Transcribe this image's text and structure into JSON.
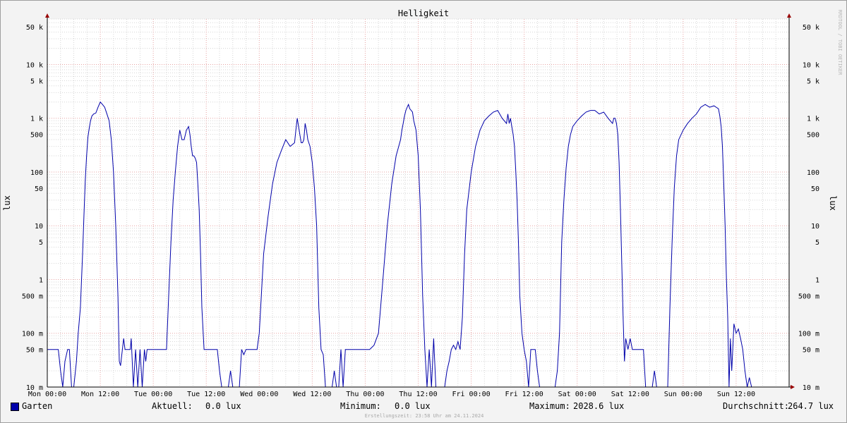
{
  "colors": {
    "background": "#f3f3f3",
    "canvas": "#ffffff",
    "line": "#0000aa",
    "grid_major": "#e7a3a3",
    "grid_minor": "#d6d6d6",
    "axis_arrow": "#990000"
  },
  "watermark": "RRDTOOL / TOBI OETIKER",
  "footer": "Erstellungszeit: 23:58 Uhr am 24.11.2024",
  "legend": {
    "series": "Garten",
    "current_label": "Aktuell:",
    "current_value": "0.0 lux",
    "min_label": "Minimum:",
    "min_value": "0.0 lux",
    "max_label": "Maximum:",
    "max_value": "2028.6 lux",
    "avg_label": "Durchschnitt:",
    "avg_value": "264.7 lux"
  },
  "chart_data": {
    "type": "line",
    "title": "Helligkeit",
    "ylabel": "lux",
    "ylabel_right": "lux",
    "y_scale": "log",
    "ylim": [
      0.01,
      70000
    ],
    "xlim_hours": [
      0,
      168
    ],
    "grid": true,
    "x_ticks": [
      "Mon 00:00",
      "Mon 12:00",
      "Tue 00:00",
      "Tue 12:00",
      "Wed 00:00",
      "Wed 12:00",
      "Thu 00:00",
      "Thu 12:00",
      "Fri 00:00",
      "Fri 12:00",
      "Sat 00:00",
      "Sat 12:00",
      "Sun 00:00",
      "Sun 12:00"
    ],
    "y_ticks": [
      {
        "value": 50000,
        "label": "50 k"
      },
      {
        "value": 10000,
        "label": "10 k"
      },
      {
        "value": 5000,
        "label": "5 k"
      },
      {
        "value": 1000,
        "label": "1 k"
      },
      {
        "value": 500,
        "label": "500"
      },
      {
        "value": 100,
        "label": "100"
      },
      {
        "value": 50,
        "label": "50"
      },
      {
        "value": 10,
        "label": "10"
      },
      {
        "value": 5,
        "label": "5"
      },
      {
        "value": 1,
        "label": "1"
      },
      {
        "value": 0.5,
        "label": "500 m"
      },
      {
        "value": 0.1,
        "label": "100 m"
      },
      {
        "value": 0.05,
        "label": "50 m"
      },
      {
        "value": 0.01,
        "label": "10 m"
      }
    ],
    "series": [
      {
        "name": "Garten",
        "color": "#0000aa",
        "hours": [
          0,
          2.5,
          3,
          3.5,
          4,
          4.6,
          5,
          5.5,
          6,
          6.6,
          7,
          7.5,
          8,
          8.3,
          8.6,
          8.9,
          9.2,
          9.5,
          9.8,
          10.1,
          10.5,
          11,
          11.5,
          12,
          12.5,
          13,
          13.5,
          14,
          14.5,
          15,
          15.5,
          16,
          16.3,
          16.6,
          17,
          17.3,
          17.6,
          17.9,
          18.2,
          18.5,
          18.8,
          19,
          19.5,
          20,
          20.5,
          21,
          21.5,
          22,
          22.3,
          22.6,
          23,
          23.4,
          23.8,
          24,
          24.5,
          25,
          25.5,
          26,
          26.5,
          27,
          27.5,
          28,
          28.5,
          29,
          29.5,
          30,
          30.5,
          31,
          31.5,
          32,
          32.3,
          32.6,
          32.9,
          33.2,
          33.5,
          33.8,
          34.1,
          34.4,
          34.7,
          35,
          35.5,
          36,
          36.5,
          37,
          37.5,
          38,
          38.5,
          39,
          39.5,
          40,
          40.5,
          41,
          41.5,
          42,
          42.5,
          43,
          43.5,
          44,
          44.5,
          45,
          45.5,
          46,
          46.5,
          47,
          47.5,
          48,
          49,
          50,
          51,
          52,
          53,
          54,
          55,
          56,
          56.3,
          56.6,
          56.9,
          57.2,
          57.5,
          57.8,
          58.1,
          58.4,
          58.7,
          59,
          59.5,
          60,
          60.5,
          61,
          61.5,
          62,
          62.5,
          63,
          63.5,
          64,
          64.5,
          65,
          65.5,
          66,
          66.5,
          67,
          67.5,
          68,
          68.5,
          69,
          69.5,
          70,
          70.5,
          71,
          72,
          73,
          74,
          75,
          76,
          77,
          78,
          79,
          80,
          80.3,
          80.6,
          80.9,
          81.2,
          81.5,
          81.8,
          82.1,
          82.4,
          82.7,
          83,
          83.5,
          84,
          84.5,
          85,
          85.5,
          86,
          86.5,
          87,
          87.5,
          88,
          88.5,
          89,
          89.5,
          90,
          90.5,
          91,
          91.5,
          92,
          92.5,
          93,
          93.5,
          94,
          94.5,
          95,
          96,
          97,
          98,
          99,
          100,
          101,
          102,
          103,
          104,
          104.3,
          104.6,
          104.9,
          105.2,
          105.5,
          105.8,
          106.1,
          106.4,
          106.7,
          107,
          107.5,
          108,
          108.5,
          109,
          109.5,
          110,
          110.5,
          111,
          111.5,
          112,
          112.5,
          113,
          113.5,
          114,
          114.5,
          115,
          115.5,
          116,
          116.5,
          117,
          117.5,
          118,
          118.5,
          119,
          120,
          121,
          122,
          123,
          124,
          125,
          126,
          127,
          128,
          128.3,
          128.6,
          128.9,
          129.2,
          129.5,
          129.8,
          130.1,
          130.4,
          130.7,
          131,
          131.5,
          132,
          132.5,
          133,
          133.5,
          134,
          134.5,
          135,
          135.5,
          136,
          136.5,
          137,
          137.5,
          138,
          138.5,
          139,
          139.5,
          140,
          140.5,
          141,
          141.5,
          142,
          142.5,
          143,
          144,
          145,
          146,
          147,
          148,
          149,
          150,
          151,
          152,
          152.3,
          152.6,
          152.9,
          153.2,
          153.5,
          153.8,
          154.1,
          154.4,
          154.7,
          155,
          155.5,
          156,
          156.5,
          157,
          157.5,
          158,
          158.5,
          159,
          159.5,
          160,
          160.5,
          161,
          161.5,
          162,
          162.5,
          163,
          163.5,
          164,
          164.5,
          165,
          165.5,
          166,
          166.5,
          167,
          168
        ],
        "values": [
          0.05,
          0.05,
          0.02,
          0.01,
          0.03,
          0.05,
          0.05,
          0.01,
          0.01,
          0.03,
          0.1,
          0.3,
          3,
          15,
          70,
          200,
          450,
          650,
          900,
          1100,
          1200,
          1250,
          1600,
          2000,
          1800,
          1600,
          1200,
          900,
          400,
          100,
          10,
          0.5,
          0.03,
          0.025,
          0.05,
          0.08,
          0.05,
          0.05,
          0.05,
          0.05,
          0.05,
          0.08,
          0.01,
          0.05,
          0.01,
          0.05,
          0.01,
          0.05,
          0.03,
          0.05,
          0.05,
          0.05,
          0.05,
          0.05,
          0.05,
          0.05,
          0.05,
          0.05,
          0.05,
          0.05,
          0.5,
          5,
          30,
          100,
          300,
          600,
          400,
          400,
          600,
          700,
          500,
          300,
          200,
          200,
          180,
          150,
          60,
          20,
          3,
          0.3,
          0.05,
          0.05,
          0.05,
          0.05,
          0.05,
          0.05,
          0.05,
          0.02,
          0.01,
          0.01,
          0.01,
          0.01,
          0.02,
          0.01,
          0.01,
          0.01,
          0.01,
          0.05,
          0.04,
          0.05,
          0.05,
          0.05,
          0.05,
          0.05,
          0.05,
          0.1,
          3,
          15,
          60,
          150,
          250,
          400,
          300,
          350,
          600,
          1000,
          700,
          500,
          350,
          350,
          400,
          800,
          600,
          400,
          300,
          150,
          50,
          10,
          0.3,
          0.05,
          0.04,
          0.01,
          0.01,
          0.01,
          0.01,
          0.02,
          0.01,
          0.01,
          0.05,
          0.01,
          0.05,
          0.05,
          0.05,
          0.05,
          0.05,
          0.05,
          0.05,
          0.05,
          0.05,
          0.05,
          0.06,
          0.1,
          1,
          10,
          60,
          200,
          400,
          600,
          800,
          1100,
          1400,
          1600,
          1800,
          1500,
          1400,
          1300,
          900,
          600,
          200,
          20,
          0.5,
          0.05,
          0.01,
          0.05,
          0.01,
          0.08,
          0.01,
          0.01,
          0.01,
          0.01,
          0.01,
          0.02,
          0.03,
          0.05,
          0.06,
          0.05,
          0.07,
          0.05,
          0.2,
          3,
          20,
          100,
          300,
          600,
          900,
          1100,
          1300,
          1400,
          1000,
          800,
          1200,
          800,
          1000,
          700,
          500,
          300,
          100,
          30,
          5,
          0.5,
          0.1,
          0.05,
          0.03,
          0.01,
          0.05,
          0.05,
          0.05,
          0.02,
          0.01,
          0.01,
          0.01,
          0.01,
          0.01,
          0.01,
          0.01,
          0.01,
          0.02,
          0.1,
          5,
          30,
          120,
          300,
          500,
          700,
          900,
          1100,
          1300,
          1400,
          1400,
          1200,
          1300,
          1000,
          800,
          1000,
          1000,
          800,
          500,
          150,
          20,
          2,
          0.2,
          0.03,
          0.08,
          0.05,
          0.08,
          0.05,
          0.05,
          0.05,
          0.05,
          0.05,
          0.05,
          0.01,
          0.01,
          0.01,
          0.01,
          0.02,
          0.01,
          0.01,
          0.01,
          0.01,
          0.01,
          0.01,
          0.3,
          5,
          50,
          200,
          400,
          600,
          800,
          1000,
          1200,
          1600,
          1800,
          1600,
          1700,
          1500,
          1100,
          700,
          300,
          60,
          10,
          1,
          0.2,
          0.01,
          0.08,
          0.02,
          0.15,
          0.1,
          0.12,
          0.08,
          0.05,
          0.02,
          0.01,
          0.015,
          0.01
        ]
      }
    ]
  }
}
